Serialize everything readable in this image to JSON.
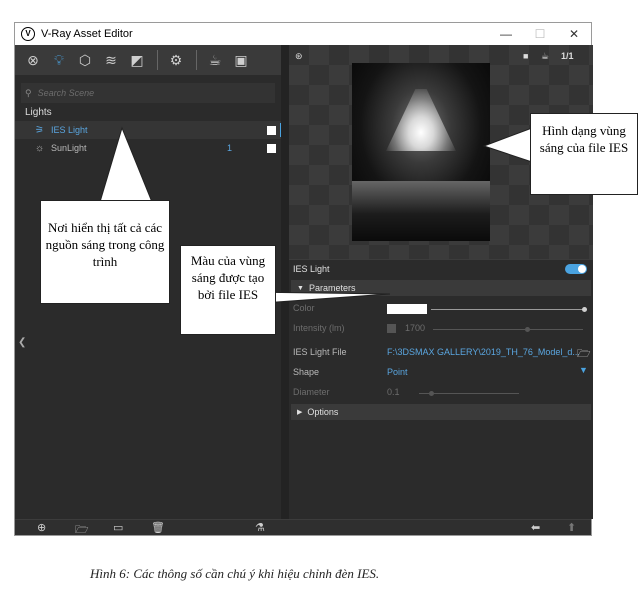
{
  "window": {
    "title": "V-Ray Asset Editor",
    "logo_text": "V",
    "controls": {
      "minimize": "—",
      "maximize": "☐",
      "close": "✕"
    }
  },
  "toolbar": {
    "icons": [
      "materials-icon",
      "lights-icon",
      "geometry-icon",
      "textures-icon",
      "render-elements-icon",
      "settings-icon",
      "teapot-render-icon",
      "frame-buffer-icon"
    ],
    "active": "lights-icon"
  },
  "left": {
    "search_placeholder": "Search Scene",
    "section": "Lights",
    "items": [
      {
        "label": "IES Light",
        "count": "",
        "icon": "ies-light-icon",
        "selected": true
      },
      {
        "label": "SunLight",
        "count": "1",
        "icon": "sun-light-icon",
        "selected": false
      }
    ]
  },
  "preview": {
    "icons": [
      "pin-icon",
      "stop-icon",
      "teapot-icon",
      "scale-icon"
    ],
    "scale_label": "1/1"
  },
  "props": {
    "header": "IES Light",
    "enabled": true,
    "parameters_group": "Parameters",
    "color_label": "Color",
    "intensity_label": "Intensity (lm)",
    "intensity_value": "1700",
    "ies_file_label": "IES Light File",
    "ies_file_value": "F:\\3DSMAX GALLERY\\2019_TH_76_Model_d...",
    "shape_label": "Shape",
    "shape_value": "Point",
    "diameter_label": "Diameter",
    "diameter_value": "0.1",
    "options_group": "Options"
  },
  "callouts": {
    "lights_list": "Nơi hiển thị tất cả các nguồn sáng trong công trình",
    "light_shape": "Hình dạng vùng sáng của file IES",
    "light_color": "Màu của vùng sáng được tạo bởi file IES"
  },
  "caption": "Hình 6: Các thông số cần chú ý khi hiệu chỉnh đèn IES.",
  "colors": {
    "accent": "#4aa3e0",
    "panel": "#2b2b2b",
    "toolbar": "#3a3a3a"
  }
}
